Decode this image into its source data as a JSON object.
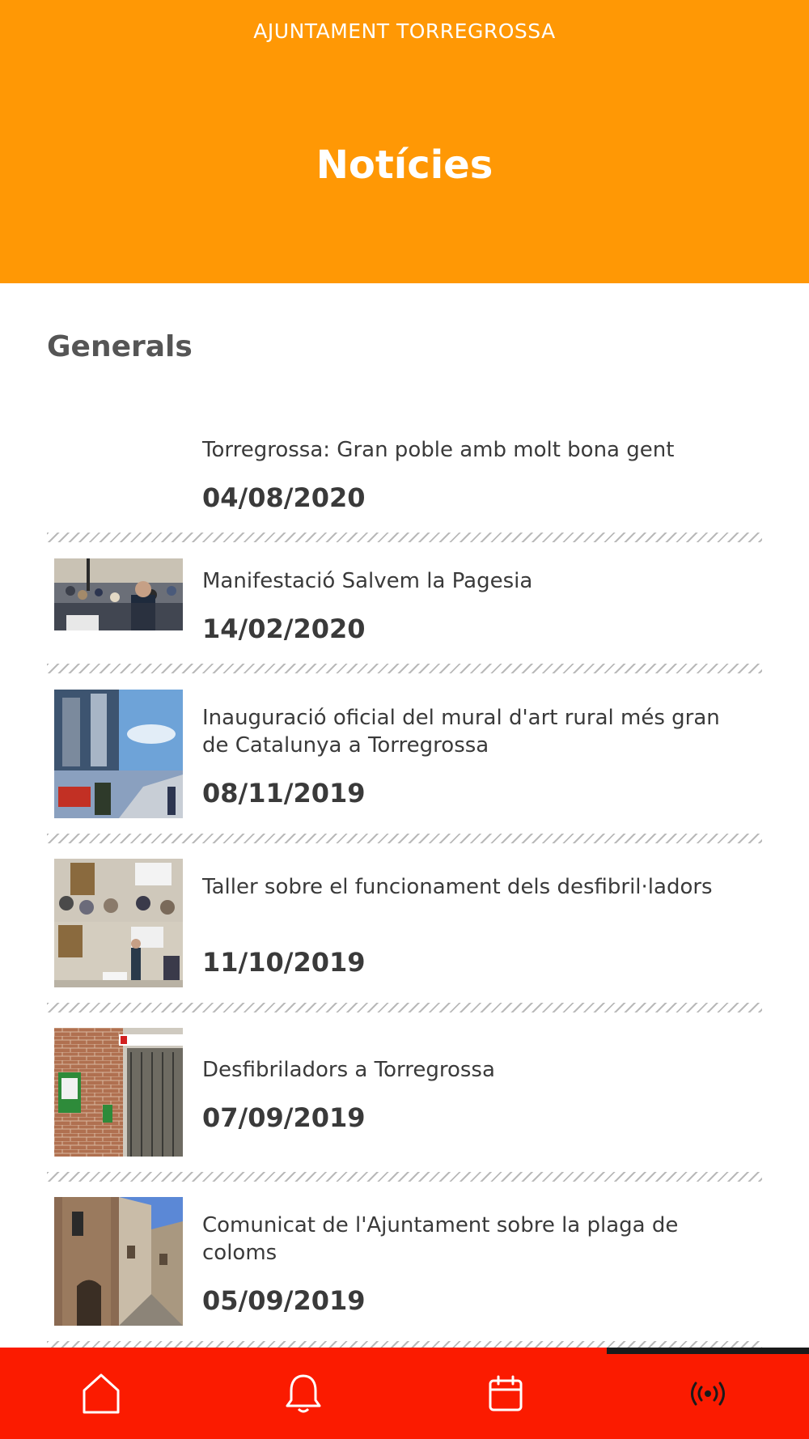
{
  "header": {
    "org_name": "AJUNTAMENT TORREGROSSA",
    "title": "Notícies",
    "background_color": "#ff9805"
  },
  "section": {
    "title": "Generals"
  },
  "news": [
    {
      "headline": "Torregrossa: Gran poble amb molt bona gent",
      "date": "04/08/2020",
      "thumbnail": "none"
    },
    {
      "headline": "Manifestació Salvem la Pagesia",
      "date": "14/02/2020",
      "thumbnail": "protest-crowd-photo"
    },
    {
      "headline": "Inauguració oficial del mural d'art rural més gran de Catalunya a Torregrossa",
      "date": "08/11/2019",
      "thumbnail": "mural-collage-photo"
    },
    {
      "headline": "Taller sobre el funcionament dels desfibril·ladors",
      "date": "11/10/2019",
      "thumbnail": "workshop-collage-photo"
    },
    {
      "headline": "Desfibriladors a Torregrossa",
      "date": "07/09/2019",
      "thumbnail": "defibrillator-wall-photo"
    },
    {
      "headline": "Comunicat de l'Ajuntament sobre la plaga de coloms",
      "date": "05/09/2019",
      "thumbnail": "bell-tower-street-photo"
    }
  ],
  "tabbar": {
    "background_color": "#fb1b00",
    "tabs": [
      {
        "icon": "home-icon"
      },
      {
        "icon": "bell-icon"
      },
      {
        "icon": "calendar-icon"
      },
      {
        "icon": "broadcast-icon",
        "active": true
      }
    ]
  }
}
